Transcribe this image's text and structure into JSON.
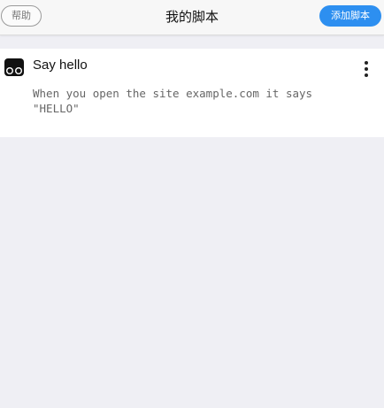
{
  "header": {
    "help_label": "帮助",
    "title": "我的脚本",
    "add_label": "添加脚本"
  },
  "scripts": [
    {
      "name": "Say hello",
      "description": "When you open the site example.com it says \"HELLO\"",
      "icon": "tampermonkey-icon"
    }
  ],
  "colors": {
    "accent": "#2d8ff0",
    "background": "#efeff4",
    "header": "#f7f7f7",
    "card": "#ffffff"
  }
}
